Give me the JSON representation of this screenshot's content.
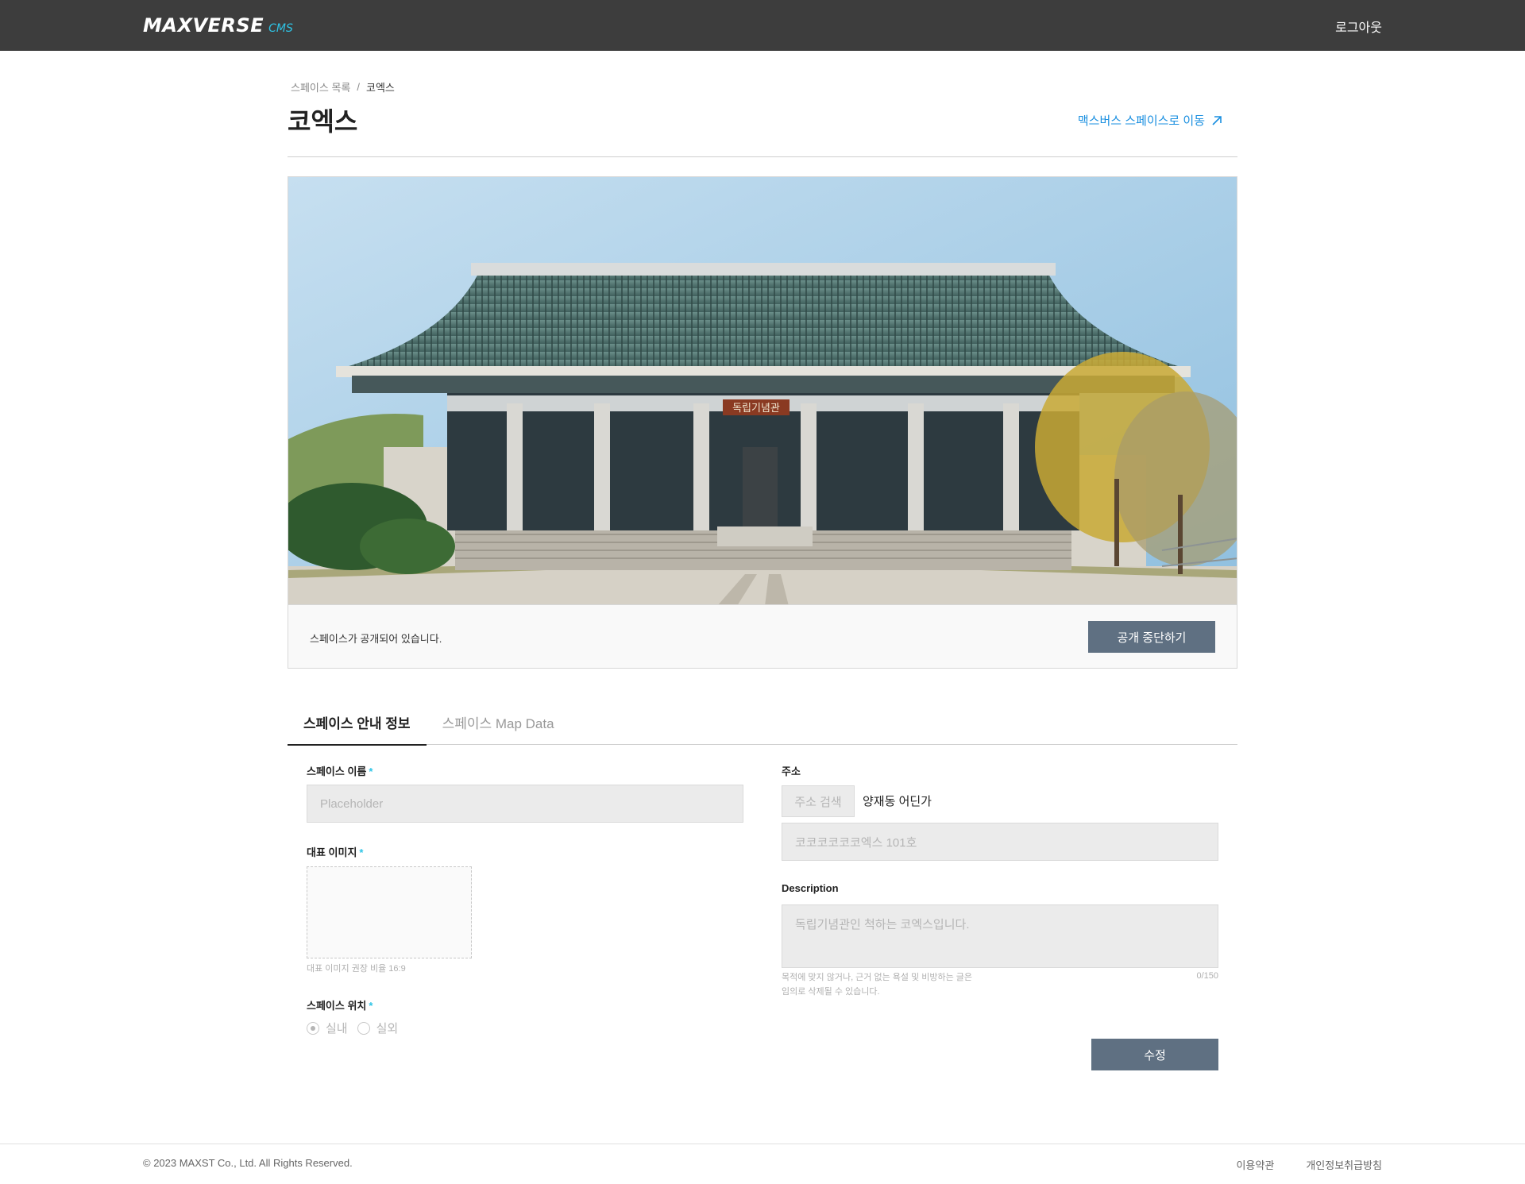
{
  "header": {
    "logo_main": "MAXVERSE",
    "logo_sub": "CMS",
    "logout": "로그아웃"
  },
  "breadcrumb": {
    "parent": "스페이스 목록",
    "separator": "/",
    "current": "코엑스"
  },
  "page_title": "코엑스",
  "external_link": {
    "label": "맥스버스 스페이스로 이동",
    "icon": "arrow-up-right-icon"
  },
  "hero": {
    "sign_text": "독립기념관",
    "status_text": "스페이스가 공개되어 있습니다.",
    "unpublish_label": "공개 중단하기"
  },
  "tabs": [
    {
      "label": "스페이스 안내 정보",
      "active": true
    },
    {
      "label": "스페이스 Map Data",
      "active": false
    }
  ],
  "form": {
    "space_name": {
      "label": "스페이스 이름",
      "required_mark": "*",
      "placeholder": "Placeholder"
    },
    "rep_image": {
      "label": "대표 이미지",
      "required_mark": "*",
      "hint": "대표 이미지 권장 비율 16:9"
    },
    "location": {
      "label": "스페이스 위치",
      "required_mark": "*",
      "options": [
        "실내",
        "실외"
      ],
      "selected": "실내"
    },
    "address": {
      "label": "주소",
      "search_button": "주소 검색",
      "value": "양재동 어딘가",
      "detail_placeholder": "코코코코코코엑스 101호"
    },
    "description": {
      "label": "Description",
      "placeholder": "독립기념관인 척하는 코엑스입니다.",
      "hint_line1": "목적에 맞지 않거나, 근거 없는 욕설 및 비방하는 글은",
      "hint_line2": "임의로 삭제될 수 있습니다.",
      "counter": "0/150"
    },
    "submit_label": "수정"
  },
  "footer": {
    "copyright": "© 2023 MAXST Co., Ltd. All Rights Reserved.",
    "links": [
      "이용약관",
      "개인정보취급방침"
    ]
  },
  "colors": {
    "header_bg": "#3d3d3d",
    "accent": "#2ec4e6",
    "link": "#1a8fe0",
    "button": "#5f7082"
  }
}
